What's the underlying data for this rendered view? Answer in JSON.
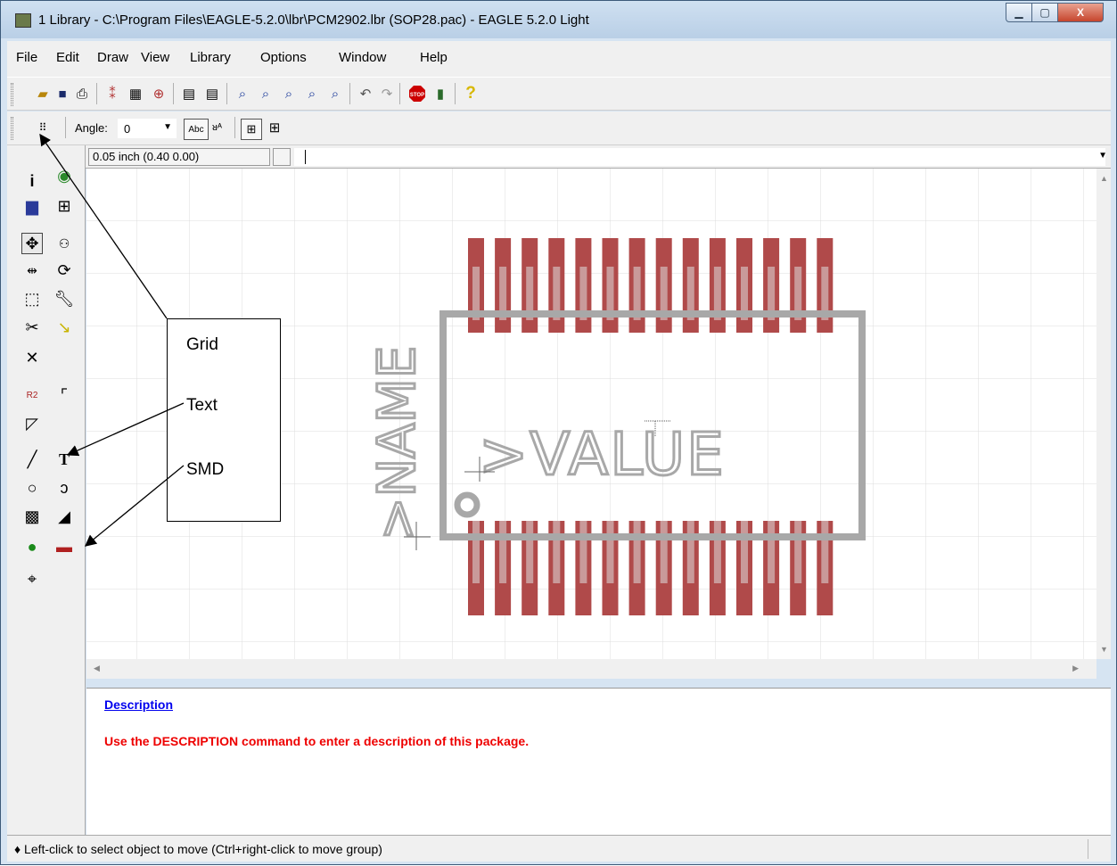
{
  "window": {
    "title": "1 Library - C:\\Program Files\\EAGLE-5.2.0\\lbr\\PCM2902.lbr (SOP28.pac) - EAGLE 5.2.0 Light",
    "min_label": "▭",
    "max_label": "▢",
    "close_label": "X"
  },
  "menu": [
    "File",
    "Edit",
    "Draw",
    "View",
    "Library",
    "Options",
    "Window",
    "Help"
  ],
  "toolbar2": {
    "angle_label": "Angle:",
    "angle_value": "0"
  },
  "coord": {
    "readout": "0.05 inch (0.40 0.00)"
  },
  "package": {
    "name_text": ">NAME",
    "value_text": ">VALUE",
    "pad_color": "#b04a4a",
    "outline_color": "#a8a8a8",
    "grid_color": "#dcdcdc",
    "pads_per_side": 14
  },
  "callout": {
    "labels": [
      "Grid",
      "Text",
      "SMD"
    ]
  },
  "description": {
    "heading": "Description",
    "body": "Use the DESCRIPTION command to enter a description of this package."
  },
  "status": {
    "text": "♦ Left-click to select object to move (Ctrl+right-click to move group)"
  },
  "icons": {
    "left_tools": [
      "info-icon",
      "eye-icon",
      "layers-icon",
      "mark-icon",
      "move-icon",
      "copy-icon",
      "mirror-icon",
      "rotate-icon",
      "group-icon",
      "change-icon",
      "cut-icon",
      "paste-icon",
      "delete-icon",
      "name-icon",
      "value-icon",
      "miter-icon",
      "split-icon",
      "wire-icon",
      "text-icon",
      "circle-icon",
      "arc-icon",
      "rect-icon",
      "polygon-icon",
      "pad-icon",
      "smd-icon",
      "hole-icon"
    ]
  }
}
